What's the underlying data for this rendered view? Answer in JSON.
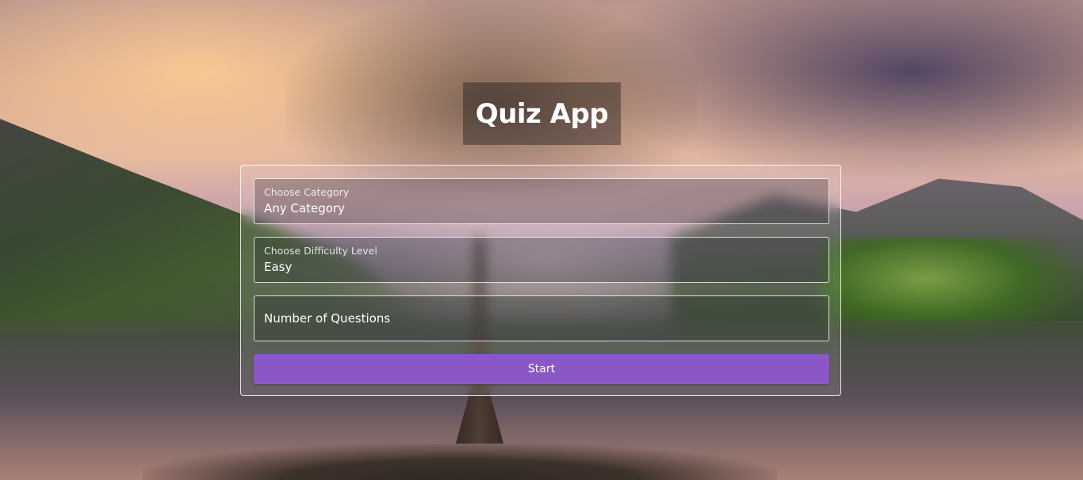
{
  "app": {
    "title": "Quiz App"
  },
  "form": {
    "category": {
      "label": "Choose Category",
      "value": "Any Category"
    },
    "difficulty": {
      "label": "Choose Difficulty Level",
      "value": "Easy"
    },
    "num_questions": {
      "placeholder": "Number of Questions",
      "value": ""
    },
    "start_label": "Start"
  },
  "colors": {
    "accent": "#8b57c6",
    "text": "#ffffff"
  }
}
